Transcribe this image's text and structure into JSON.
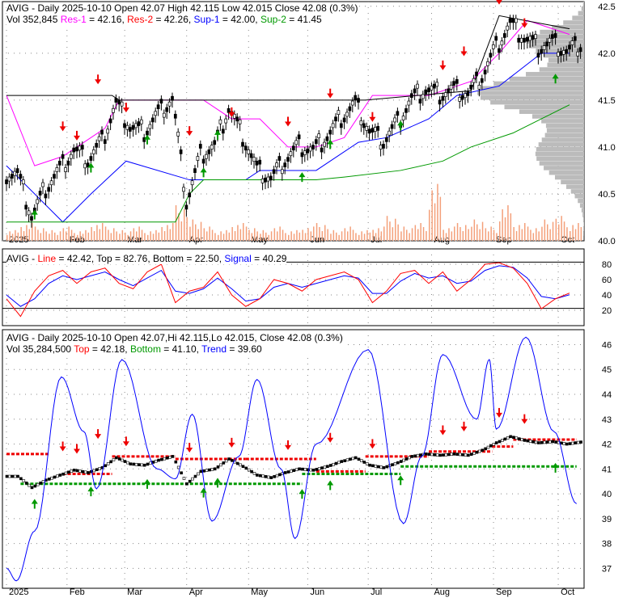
{
  "panel1": {
    "line1": "AVIG - Daily 2025-10-10 Open 42.07  High 42.115  Low 42.015  Close 42.08 (0.3%)",
    "vol": "Vol 352,845",
    "res1": "Res-1",
    "res1_val": " = 42.16, ",
    "res2": "Res-2",
    "res2_val": " = 42.26, ",
    "sup1": "Sup-1",
    "sup1_val": " = 42.00, ",
    "sup2": "Sup-2",
    "sup2_val": " = 41.45"
  },
  "panel2": {
    "prefix": "AVIG - ",
    "line": "Line",
    "rest": " = 42.42, Top = 82.76, Bottom = 22.50, ",
    "signal": "Signal",
    "signal_val": " = 40.29"
  },
  "panel3": {
    "line1": "AVIG - Daily 2025-10-10 Open 42.07,Hi 42.115,Lo 42.015, Close 42.08 (0.3%)",
    "vol": "Vol 35,284,500 ",
    "top": "Top",
    "top_val": " = 42.18, ",
    "bottom": "Bottom",
    "bottom_val": " = 41.10, ",
    "trend": "Trend",
    "trend_val": " = 39.60"
  },
  "colors": {
    "res1": "#ff00ff",
    "res2": "#ff0000",
    "sup1": "#0000ff",
    "sup2": "#009900",
    "volume": "#f4a07a",
    "profile": "#bbbbbb"
  },
  "chart_data": [
    {
      "type": "line",
      "title": "AVIG Daily price with support/resistance",
      "x_unit": "week",
      "months": [
        "2025",
        "Feb",
        "Mar",
        "Apr",
        "May",
        "Jun",
        "Jul",
        "Aug",
        "Sep",
        "Oct"
      ],
      "month_weeks": [
        0,
        4.3,
        8.4,
        12.8,
        17.2,
        21.4,
        25.7,
        30.2,
        34.6,
        39.2
      ],
      "yticks": [
        40.0,
        40.5,
        41.0,
        41.5,
        42.0,
        42.5
      ],
      "ylim": [
        40.0,
        42.55
      ],
      "close": [
        40.7,
        40.25,
        40.55,
        40.75,
        40.95,
        40.85,
        41.05,
        41.45,
        41.2,
        41.15,
        41.35,
        41.5,
        40.4,
        40.9,
        41.0,
        41.4,
        41.1,
        40.75,
        40.65,
        40.85,
        41.0,
        40.95,
        41.1,
        41.3,
        41.45,
        41.15,
        41.05,
        41.25,
        41.5,
        41.6,
        41.55,
        41.6,
        41.55,
        41.75,
        42.05,
        42.3,
        42.15,
        42.05,
        42.1,
        42.0,
        42.08
      ],
      "volume": [
        0.3,
        0.5,
        0.4,
        0.3,
        0.4,
        0.3,
        0.5,
        0.4,
        0.3,
        0.4,
        0.3,
        0.5,
        1.0,
        0.6,
        0.4,
        0.3,
        0.5,
        0.4,
        0.3,
        0.4,
        0.3,
        0.4,
        0.5,
        0.3,
        0.4,
        0.3,
        0.4,
        0.7,
        0.4,
        0.5,
        1.6,
        0.4,
        0.5,
        0.6,
        0.4,
        1.0,
        0.5,
        0.4,
        0.6,
        0.7,
        0.5
      ],
      "res1": [
        [
          0,
          41.55
        ],
        [
          2,
          40.8
        ],
        [
          4,
          40.9
        ],
        [
          7,
          41.2
        ],
        [
          8,
          41.5
        ],
        [
          12,
          41.5
        ],
        [
          14,
          41.5
        ],
        [
          16,
          41.3
        ],
        [
          18,
          41.3
        ],
        [
          20,
          41.0
        ],
        [
          22,
          41.0
        ],
        [
          24,
          41.1
        ],
        [
          26,
          41.55
        ],
        [
          30,
          41.55
        ],
        [
          33,
          41.7
        ],
        [
          35,
          42.0
        ],
        [
          37,
          42.35
        ],
        [
          40,
          42.2
        ]
      ],
      "res2": [
        [
          0,
          41.55
        ],
        [
          7.5,
          41.55
        ],
        [
          8,
          41.5
        ],
        [
          13,
          41.5
        ],
        [
          25,
          41.5
        ],
        [
          25.5,
          41.5
        ],
        [
          33,
          41.6
        ],
        [
          35,
          42.4
        ],
        [
          40,
          42.26
        ]
      ],
      "sup1": [
        [
          0,
          40.8
        ],
        [
          4,
          40.2
        ],
        [
          6,
          40.5
        ],
        [
          8.5,
          40.85
        ],
        [
          13,
          40.65
        ],
        [
          17,
          40.65
        ],
        [
          18,
          40.75
        ],
        [
          22,
          40.75
        ],
        [
          25,
          41.05
        ],
        [
          27,
          41.1
        ],
        [
          30,
          41.3
        ],
        [
          32,
          41.55
        ],
        [
          35,
          41.65
        ],
        [
          38,
          42.0
        ],
        [
          40,
          42.0
        ]
      ],
      "sup2": [
        [
          0,
          40.2
        ],
        [
          12,
          40.2
        ],
        [
          13,
          40.5
        ],
        [
          14,
          40.65
        ],
        [
          22,
          40.65
        ],
        [
          24,
          40.68
        ],
        [
          28,
          40.75
        ],
        [
          31,
          40.85
        ],
        [
          33,
          41.0
        ],
        [
          36,
          41.15
        ],
        [
          38,
          41.3
        ],
        [
          40,
          41.45
        ]
      ],
      "buy_arrows": [
        2,
        6,
        10,
        14,
        15,
        21,
        23,
        28,
        39
      ],
      "sell_arrows": [
        4,
        5,
        6.5,
        8.5,
        13,
        16,
        20,
        23,
        26,
        31,
        32.5,
        35,
        36.8
      ]
    },
    {
      "type": "line",
      "title": "Oscillator",
      "yticks": [
        20,
        40,
        60,
        80
      ],
      "ylim": [
        0,
        100
      ],
      "line": [
        35,
        12,
        45,
        65,
        72,
        55,
        70,
        75,
        55,
        48,
        70,
        80,
        30,
        45,
        50,
        70,
        40,
        25,
        35,
        60,
        55,
        45,
        60,
        65,
        70,
        60,
        30,
        45,
        68,
        72,
        55,
        70,
        45,
        60,
        80,
        82,
        75,
        55,
        22,
        35,
        42.42
      ],
      "signal": [
        40,
        25,
        35,
        55,
        65,
        60,
        65,
        70,
        60,
        52,
        62,
        72,
        45,
        42,
        48,
        62,
        48,
        32,
        35,
        50,
        55,
        50,
        55,
        60,
        65,
        62,
        42,
        42,
        58,
        68,
        62,
        65,
        55,
        58,
        72,
        78,
        76,
        62,
        38,
        35,
        40.29
      ],
      "top": 82.76,
      "bottom": 22.5
    },
    {
      "type": "line",
      "title": "Trend",
      "yticks": [
        37,
        38,
        39,
        40,
        41,
        42,
        43,
        44,
        45,
        46
      ],
      "ylim": [
        36.2,
        46.6
      ],
      "trend": [
        [
          0,
          37.0
        ],
        [
          0.7,
          36.5
        ],
        [
          2,
          38.5
        ],
        [
          3.9,
          44.7
        ],
        [
          5.5,
          42.5
        ],
        [
          6.4,
          40.2
        ],
        [
          8.2,
          45.4
        ],
        [
          10.7,
          41.0
        ],
        [
          12,
          40.6
        ],
        [
          13.2,
          43.2
        ],
        [
          14.6,
          38.9
        ],
        [
          16.5,
          41.5
        ],
        [
          17.8,
          44.6
        ],
        [
          19.5,
          41.0
        ],
        [
          20.5,
          38.2
        ],
        [
          22,
          42.0
        ],
        [
          25.7,
          45.8
        ],
        [
          28.2,
          38.8
        ],
        [
          29.5,
          41.5
        ],
        [
          31,
          45.6
        ],
        [
          33.4,
          43.0
        ],
        [
          34.3,
          45.4
        ],
        [
          34.8,
          42.6
        ],
        [
          36.9,
          46.3
        ],
        [
          38.9,
          42.5
        ],
        [
          40.5,
          39.6
        ]
      ],
      "top_levels": [
        [
          0,
          3,
          41.6
        ],
        [
          4,
          7.5,
          40.8
        ],
        [
          7.5,
          12,
          41.5
        ],
        [
          12,
          17,
          41.4
        ],
        [
          17,
          22,
          41.4
        ],
        [
          22,
          25.5,
          40.9
        ],
        [
          25.5,
          30,
          41.5
        ],
        [
          30,
          34.5,
          41.7
        ],
        [
          34.5,
          36,
          41.9
        ],
        [
          36,
          40.5,
          42.18
        ]
      ],
      "bottom_levels": [
        [
          1,
          12,
          40.4
        ],
        [
          12,
          21,
          40.4
        ],
        [
          21,
          28,
          40.8
        ],
        [
          28,
          40.5,
          41.1
        ]
      ]
    }
  ]
}
